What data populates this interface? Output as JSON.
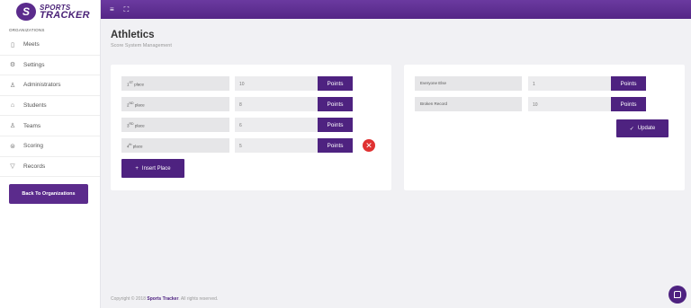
{
  "brand": {
    "line1": "SPORTS",
    "line2": "TRACKER",
    "mark": "S"
  },
  "sidebar": {
    "section_label": "ORGANIZATIONS",
    "items": [
      {
        "label": "Meets",
        "icon": "calendar-icon",
        "glyph": "▯"
      },
      {
        "label": "Settings",
        "icon": "gear-icon",
        "glyph": "⚙"
      },
      {
        "label": "Administrators",
        "icon": "admins-icon",
        "glyph": "♙"
      },
      {
        "label": "Students",
        "icon": "graduation-cap-icon",
        "glyph": "⌂"
      },
      {
        "label": "Teams",
        "icon": "team-icon",
        "glyph": "♙"
      },
      {
        "label": "Scoring",
        "icon": "scoring-icon",
        "glyph": "⊜"
      },
      {
        "label": "Records",
        "icon": "trophy-icon",
        "glyph": "▽"
      }
    ],
    "back_button": "Back To Organizations"
  },
  "topbar": {
    "menu_icon": "≡",
    "fullscreen_icon": "⛶"
  },
  "page": {
    "title": "Athletics",
    "subtitle": "Score System Management"
  },
  "places": [
    {
      "num": "1",
      "suffix": "ST",
      "word": "place",
      "value": "10",
      "button": "Points"
    },
    {
      "num": "2",
      "suffix": "ND",
      "word": "place",
      "value": "8",
      "button": "Points"
    },
    {
      "num": "3",
      "suffix": "RD",
      "word": "place",
      "value": "6",
      "button": "Points"
    },
    {
      "num": "4",
      "suffix": "th",
      "word": "place",
      "value": "5",
      "button": "Points"
    }
  ],
  "delete_glyph": "✕",
  "insert_button": {
    "icon": "+",
    "label": "Insert Place"
  },
  "special": [
    {
      "label": "Everyone Else",
      "value": "1",
      "button": "Points"
    },
    {
      "label": "Broken Record",
      "value": "10",
      "button": "Points"
    }
  ],
  "update_button": {
    "icon": "✓",
    "label": "Update"
  },
  "footer": {
    "prefix": "Copyright © 2018",
    "brand": "Sports Tracker",
    "suffix": ". All rights reserved."
  },
  "colors": {
    "primary": "#4e2280",
    "topbar": "#5b2b8c",
    "danger": "#e03131",
    "background": "#f1f1f4"
  }
}
